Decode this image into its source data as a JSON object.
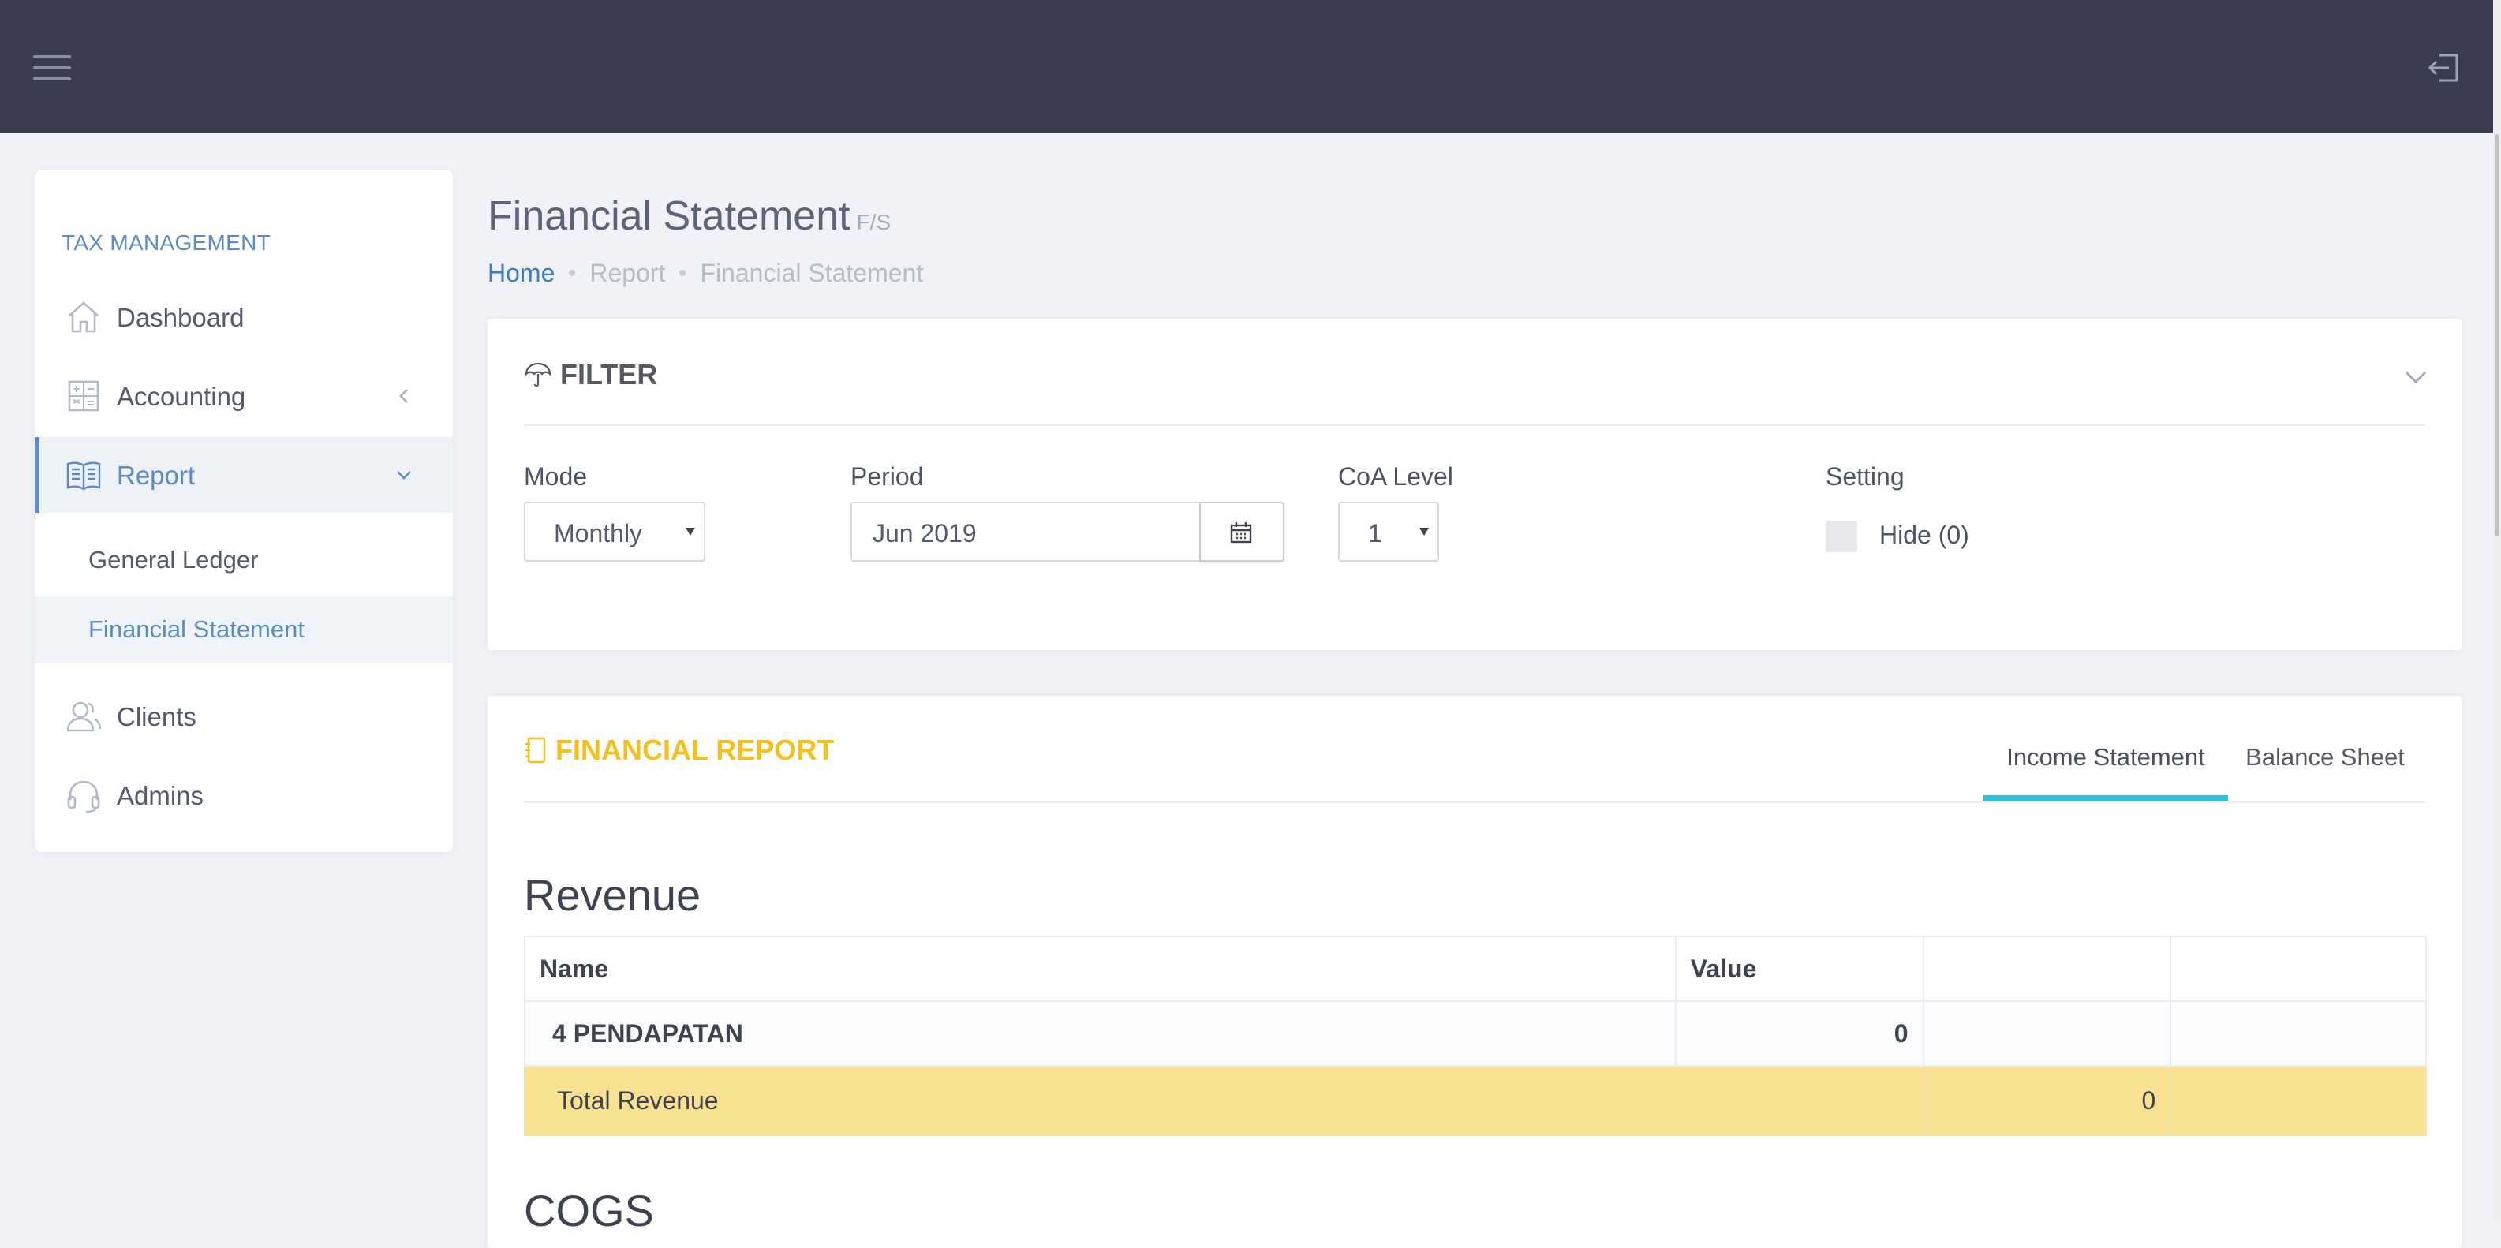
{
  "header": {
    "menu_icon": "hamburger-icon",
    "logout_icon": "logout-icon",
    "bg_color": "#3a3d50"
  },
  "sidebar": {
    "section_title": "TAX MANAGEMENT",
    "items": [
      {
        "label": "Dashboard",
        "icon": "home-icon"
      },
      {
        "label": "Accounting",
        "icon": "calculator-icon"
      },
      {
        "label": "Report",
        "icon": "book-icon"
      },
      {
        "label": "Clients",
        "icon": "users-icon"
      },
      {
        "label": "Admins",
        "icon": "headset-icon"
      }
    ],
    "subitems": [
      {
        "label": "General Ledger"
      },
      {
        "label": "Financial Statement"
      }
    ],
    "accent_color": "#5b8dc4"
  },
  "page": {
    "title": "Financial Statement",
    "subtitle": "F/S",
    "breadcrumb": [
      "Home",
      "Report",
      "Financial Statement"
    ]
  },
  "filter": {
    "title": "FILTER",
    "mode_label": "Mode",
    "mode_value": "Monthly",
    "period_label": "Period",
    "period_value": "Jun 2019",
    "coa_label": "CoA Level",
    "coa_value": "1",
    "setting_label": "Setting",
    "hide_label": "Hide (0)"
  },
  "report": {
    "title": "FINANCIAL REPORT",
    "title_color": "#f4c01e",
    "tabs": [
      "Income Statement",
      "Balance Sheet"
    ],
    "tab_active_color": "#34bfd6",
    "revenue_heading": "Revenue",
    "columns": [
      "Name",
      "Value"
    ],
    "rows": [
      {
        "name": "4 PENDAPATAN",
        "value": "0"
      }
    ],
    "total_label": "Total Revenue",
    "total_value": "0",
    "total_color": "#f8e291",
    "next_heading": "COGS"
  }
}
